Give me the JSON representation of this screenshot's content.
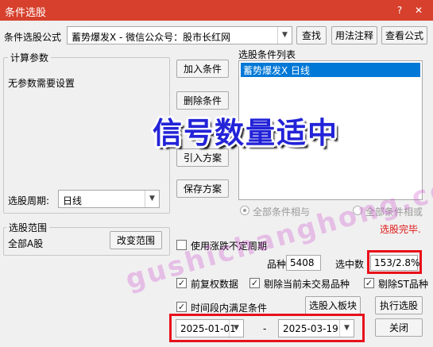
{
  "window": {
    "title": "条件选股",
    "help_icon": "?",
    "close_icon": "✕"
  },
  "formula": {
    "label": "条件选股公式",
    "selected": "蓄势爆发X  -  微信公众号：股市长红网",
    "find_button": "查找",
    "usage_button": "用法注释",
    "view_button": "查看公式"
  },
  "params": {
    "group_label": "计算参数",
    "note": "无参数需要设置",
    "period_label": "选股周期:",
    "period_value": "日线"
  },
  "condition_buttons": {
    "add": "加入条件",
    "delete": "删除条件",
    "import": "引入方案",
    "save": "保存方案"
  },
  "condition_list": {
    "label": "选股条件列表",
    "items": [
      "蓄势爆发X  日线"
    ]
  },
  "logic": {
    "and_label": "全部条件相与",
    "or_label": "全部条件相或"
  },
  "status": {
    "text": "选股完毕."
  },
  "scope": {
    "group_label": "选股范围",
    "value": "全部A股",
    "change_button": "改变范围"
  },
  "options": {
    "variable_period_label": "使用涨跌不定周期",
    "count_label": "品种数",
    "count_value": "5408",
    "selected_label": "选中数",
    "selected_value": "153/2.8%",
    "adj_label": "前复权数据",
    "exclude_untraded_label": "剔除当前未交易品种",
    "exclude_st_label": "剔除ST品种",
    "time_range_label": "时间段内满足条件"
  },
  "actions": {
    "to_block": "选股入板块",
    "run": "执行选股",
    "close": "关闭"
  },
  "date_range": {
    "start": "2025-01-01",
    "separator": "-",
    "end": "2025-03-19"
  },
  "overlay": {
    "headline": "信号数量适中"
  },
  "watermark": {
    "text": "gushichanghong.com"
  },
  "colors": {
    "title_bar": "#d6402c",
    "highlight_box": "#e8111b",
    "list_selection": "#0078d7",
    "headline": "#2323d8"
  }
}
